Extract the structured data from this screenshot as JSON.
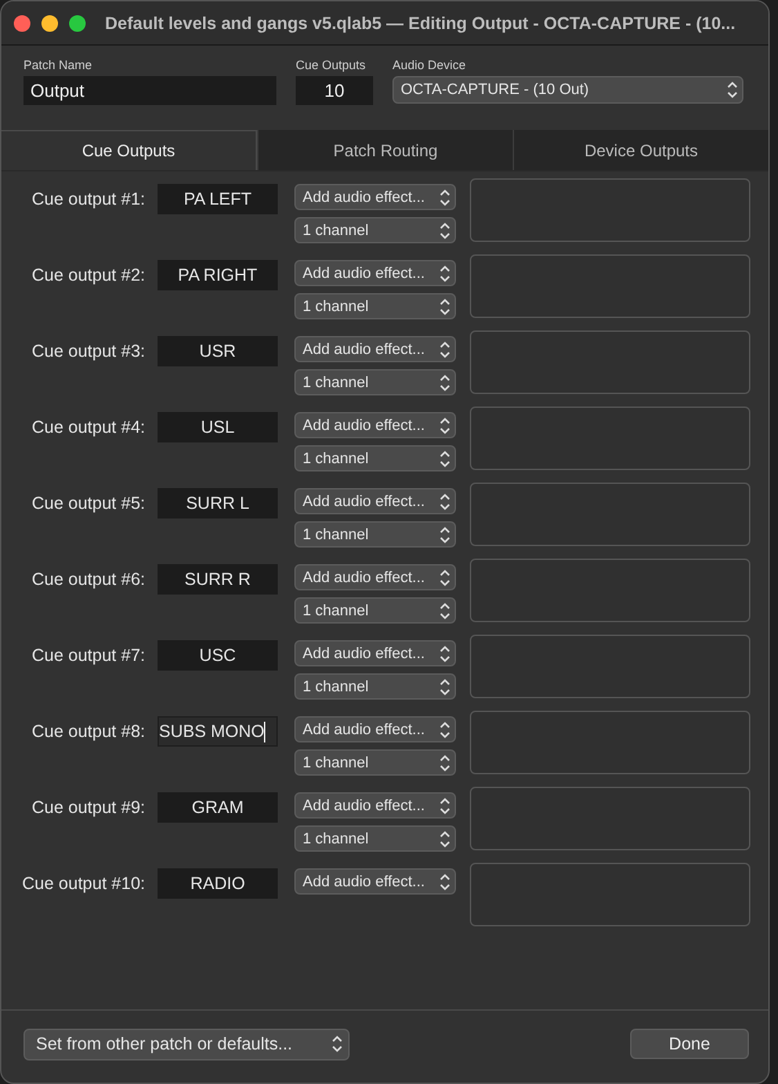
{
  "window": {
    "title": "Default levels and gangs v5.qlab5 — Editing Output - OCTA-CAPTURE - (10..."
  },
  "header": {
    "patch_name_label": "Patch Name",
    "patch_name": "Output",
    "cue_outputs_label": "Cue Outputs",
    "cue_outputs": "10",
    "audio_device_label": "Audio Device",
    "audio_device": "OCTA-CAPTURE - (10 Out)"
  },
  "tabs": [
    {
      "label": "Cue Outputs",
      "selected": true
    },
    {
      "label": "Patch Routing",
      "selected": false
    },
    {
      "label": "Device Outputs",
      "selected": false
    }
  ],
  "outputs": [
    {
      "label": "Cue output #1:",
      "name": "PA LEFT",
      "editing": false,
      "effect": "Add audio effect...",
      "channels": "1 channel"
    },
    {
      "label": "Cue output #2:",
      "name": "PA RIGHT",
      "editing": false,
      "effect": "Add audio effect...",
      "channels": "1 channel"
    },
    {
      "label": "Cue output #3:",
      "name": "USR",
      "editing": false,
      "effect": "Add audio effect...",
      "channels": "1 channel"
    },
    {
      "label": "Cue output #4:",
      "name": "USL",
      "editing": false,
      "effect": "Add audio effect...",
      "channels": "1 channel"
    },
    {
      "label": "Cue output #5:",
      "name": "SURR L",
      "editing": false,
      "effect": "Add audio effect...",
      "channels": "1 channel"
    },
    {
      "label": "Cue output #6:",
      "name": "SURR R",
      "editing": false,
      "effect": "Add audio effect...",
      "channels": "1 channel"
    },
    {
      "label": "Cue output #7:",
      "name": "USC",
      "editing": false,
      "effect": "Add audio effect...",
      "channels": "1 channel"
    },
    {
      "label": "Cue output #8:",
      "name": "SUBS MONO",
      "editing": true,
      "effect": "Add audio effect...",
      "channels": "1 channel"
    },
    {
      "label": "Cue output #9:",
      "name": "GRAM",
      "editing": false,
      "effect": "Add audio effect...",
      "channels": "1 channel"
    },
    {
      "label": "Cue output #10:",
      "name": "RADIO",
      "editing": false,
      "effect": "Add audio effect..."
    }
  ],
  "footer": {
    "preset_menu": "Set from other patch or defaults...",
    "done_button": "Done"
  }
}
